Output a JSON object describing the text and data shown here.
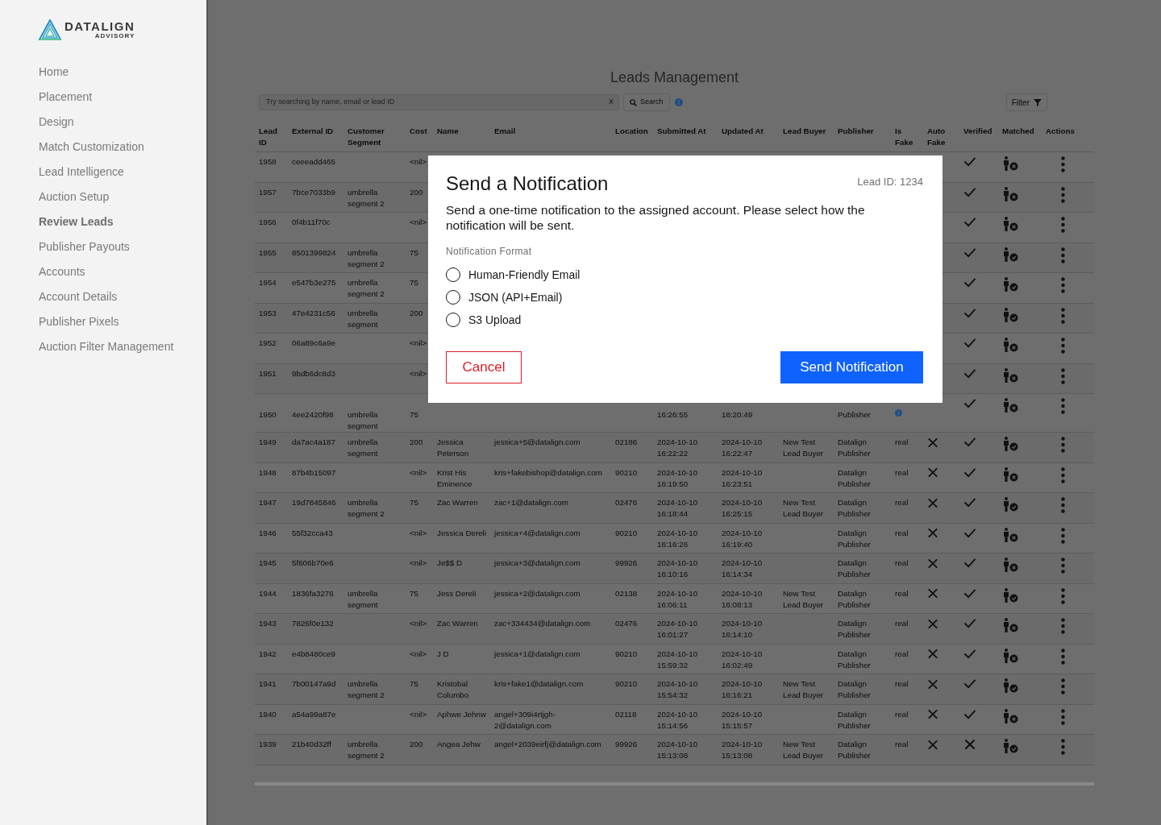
{
  "sidebar": {
    "logo": {
      "name": "DATALIGN",
      "tagline": "ADVISORY"
    },
    "items": [
      {
        "label": "Home",
        "selected": false
      },
      {
        "label": "Placement",
        "selected": false
      },
      {
        "label": "Design",
        "selected": false
      },
      {
        "label": "Match Customization",
        "selected": false
      },
      {
        "label": "Lead Intelligence",
        "selected": false
      },
      {
        "label": "Auction Setup",
        "selected": false
      },
      {
        "label": "Review Leads",
        "selected": true
      },
      {
        "label": "Publisher Payouts",
        "selected": false
      },
      {
        "label": "Accounts",
        "selected": false
      },
      {
        "label": "Account Details",
        "selected": false
      },
      {
        "label": "Publisher Pixels",
        "selected": false
      },
      {
        "label": "Auction Filter Management",
        "selected": false
      }
    ]
  },
  "page": {
    "title": "Leads Management",
    "search": {
      "placeholder": "Try searching by name, email or lead ID",
      "clear": "X",
      "button": "Search"
    },
    "filter": "Filter"
  },
  "table": {
    "columns": [
      "Lead ID",
      "External ID",
      "Customer Segment",
      "Cost",
      "Name",
      "Email",
      "Location",
      "Submitted At",
      "Updated At",
      "Lead Buyer",
      "Publisher",
      "Is Fake",
      "Auto Fake",
      "Verified",
      "Matched",
      "Actions"
    ],
    "rows": [
      {
        "cells": [
          "1958",
          "ceeeadd465",
          null,
          "<nil>",
          null,
          null,
          null,
          null,
          null,
          null,
          null,
          null
        ],
        "verified": true,
        "matched": false
      },
      {
        "cells": [
          "1957",
          "7bce7033b9",
          "umbrella segment 2",
          "200",
          null,
          null,
          null,
          null,
          null,
          null,
          null,
          null
        ],
        "verified": true,
        "matched": false
      },
      {
        "cells": [
          "1956",
          "0f4b11f70c",
          null,
          "<nil>",
          null,
          null,
          null,
          null,
          null,
          null,
          null,
          null
        ],
        "verified": true,
        "matched": false
      },
      {
        "cells": [
          "1955",
          "8501399824",
          "umbrella segment 2",
          "75",
          null,
          null,
          null,
          null,
          null,
          null,
          null,
          null
        ],
        "verified": true,
        "matched": true
      },
      {
        "cells": [
          "1954",
          "e547b3e275",
          "umbrella segment 2",
          "75",
          null,
          null,
          null,
          null,
          null,
          null,
          null,
          null
        ],
        "verified": true,
        "matched": true
      },
      {
        "cells": [
          "1953",
          "47e4231c56",
          "umbrella segment",
          "200",
          null,
          null,
          null,
          null,
          null,
          null,
          null,
          null
        ],
        "verified": true,
        "matched": true
      },
      {
        "cells": [
          "1952",
          "06a89c6a9e",
          null,
          "<nil>",
          null,
          null,
          null,
          null,
          null,
          null,
          null,
          null
        ],
        "verified": true,
        "matched": false
      },
      {
        "cells": [
          "1951",
          "9bdb6dc8d3",
          null,
          "<nil>",
          null,
          null,
          null,
          null,
          null,
          null,
          null,
          null
        ],
        "verified": true,
        "matched": false
      },
      {
        "cells": [
          "1950",
          "4ee2420f98",
          "umbrella segment",
          "75",
          null,
          null,
          null,
          "16:26:55",
          "18:20:49",
          null,
          "Publisher",
          null
        ],
        "fake_info": true,
        "verified": true,
        "matched": false
      },
      {
        "cells": [
          "1949",
          "da7ac4a187",
          "umbrella segment",
          "200",
          "Jessica Peterson",
          "jessica+5@datalign.com",
          "02186",
          "2024-10-10 16:22:22",
          "2024-10-10 16:22:47",
          "New Test Lead Buyer",
          "Datalign Publisher",
          "real"
        ],
        "auto_fake": false,
        "verified": true,
        "matched": true
      },
      {
        "cells": [
          "1948",
          "87b4b15097",
          null,
          "<nil>",
          "Krist His Eminence",
          "kris+fakebishop@datalign.com",
          "90210",
          "2024-10-10 16:19:50",
          "2024-10-10 16:23:51",
          null,
          "Datalign Publisher",
          "real"
        ],
        "auto_fake": false,
        "verified": true,
        "matched": false
      },
      {
        "cells": [
          "1947",
          "19d7845846",
          "umbrella segment 2",
          "75",
          "Zac Warren",
          "zac+1@datalign.com",
          "02476",
          "2024-10-10 16:18:44",
          "2024-10-10 16:25:15",
          "New Test Lead Buyer",
          "Datalign Publisher",
          "real"
        ],
        "auto_fake": false,
        "verified": true,
        "matched": true
      },
      {
        "cells": [
          "1946",
          "55f32cca43",
          null,
          "<nil>",
          "Jessica Dereli",
          "jessica+4@datalign.com",
          "90210",
          "2024-10-10 16:16:26",
          "2024-10-10 16:19:40",
          null,
          "Datalign Publisher",
          "real"
        ],
        "auto_fake": false,
        "verified": true,
        "matched": false
      },
      {
        "cells": [
          "1945",
          "5f606b70e6",
          null,
          "<nil>",
          "Je$$ D",
          "jessica+3@datalign.com",
          "99926",
          "2024-10-10 16:10:16",
          "2024-10-10 16:14:34",
          null,
          "Datalign Publisher",
          "real"
        ],
        "auto_fake": false,
        "verified": true,
        "matched": false
      },
      {
        "cells": [
          "1944",
          "1836fa3276",
          "umbrella segment",
          "75",
          "Jess Dereli",
          "jessica+2@datalign.com",
          "02138",
          "2024-10-10 16:06:11",
          "2024-10-10 16:08:13",
          "New Test Lead Buyer",
          "Datalign Publisher",
          "real"
        ],
        "auto_fake": false,
        "verified": true,
        "matched": true
      },
      {
        "cells": [
          "1943",
          "7826f0e132",
          null,
          "<nil>",
          "Zac Warren",
          "zac+334434@datalign.com",
          "02476",
          "2024-10-10 16:01:27",
          "2024-10-10 16:14:10",
          null,
          "Datalign Publisher",
          "real"
        ],
        "auto_fake": false,
        "verified": true,
        "matched": false
      },
      {
        "cells": [
          "1942",
          "e4b8480ce9",
          null,
          "<nil>",
          "J D",
          "jessica+1@datalign.com",
          "90210",
          "2024-10-10 15:59:32",
          "2024-10-10 16:02:49",
          null,
          "Datalign Publisher",
          "real"
        ],
        "auto_fake": false,
        "verified": true,
        "matched": false
      },
      {
        "cells": [
          "1941",
          "7b00147a9d",
          "umbrella segment 2",
          "75",
          "Kristobal Columbo",
          "kris+fake1@datalign.com",
          "90210",
          "2024-10-10 15:54:32",
          "2024-10-10 16:16:21",
          "New Test Lead Buyer",
          "Datalign Publisher",
          "real"
        ],
        "auto_fake": false,
        "verified": true,
        "matched": true
      },
      {
        "cells": [
          "1940",
          "a54a99a87e",
          null,
          "<nil>",
          "Aphwe Jehnw",
          "angel+309i4rtjgh-2@datalign.com",
          "02118",
          "2024-10-10 15:14:56",
          "2024-10-10 15:15:57",
          null,
          "Datalign Publisher",
          "real"
        ],
        "auto_fake": false,
        "verified": true,
        "matched": false
      },
      {
        "cells": [
          "1939",
          "21b40d32ff",
          "umbrella segment 2",
          "200",
          "Angea Jehw",
          "angel+2039eirfj@datalign.com",
          "99926",
          "2024-10-10 15:13:08",
          "2024-10-10 15:13:08",
          "New Test Lead Buyer",
          "Datalign Publisher",
          "real"
        ],
        "auto_fake": false,
        "verified": false,
        "matched": true
      }
    ]
  },
  "modal": {
    "title": "Send a Notification",
    "lead_id": "Lead ID: 1234",
    "description": "Send a one-time notification to the assigned account. Please select how the notification will be sent.",
    "format_label": "Notification Format",
    "options": [
      {
        "label": "Human-Friendly Email",
        "selected": false
      },
      {
        "label": "JSON (API+Email)",
        "selected": false
      },
      {
        "label": "S3 Upload",
        "selected": false
      }
    ],
    "cancel": "Cancel",
    "submit": "Send Notification"
  }
}
